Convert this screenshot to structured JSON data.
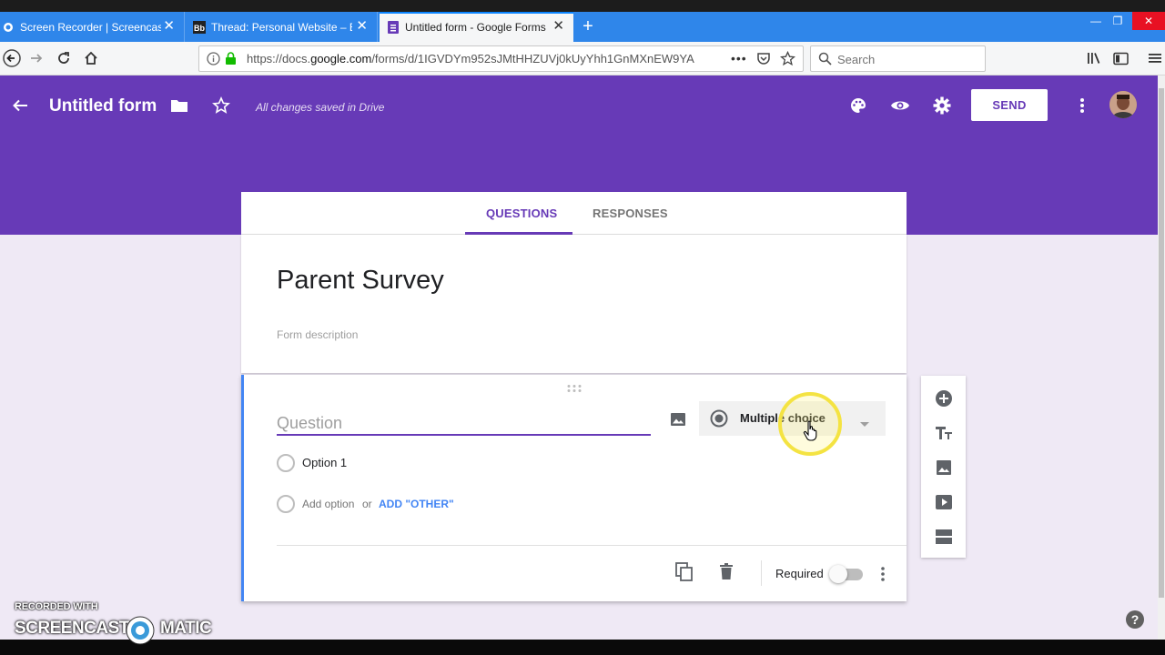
{
  "browser": {
    "tabs": [
      {
        "title": "Screen Recorder | Screencast-O"
      },
      {
        "title": "Thread: Personal Website – ED"
      },
      {
        "title": "Untitled form - Google Forms"
      }
    ],
    "url_prefix": "https://docs.",
    "url_host": "google.com",
    "url_rest": "/forms/d/1IGVDYm952sJMtHHZUVj0kUyYhh1GnMXnEW9YA",
    "search_placeholder": "Search"
  },
  "forms_header": {
    "title": "Untitled form",
    "save_status": "All changes saved in Drive",
    "send_label": "SEND"
  },
  "form_tabs": {
    "questions": "QUESTIONS",
    "responses": "RESPONSES",
    "active": "questions"
  },
  "form": {
    "title": "Parent Survey",
    "description_placeholder": "Form description"
  },
  "question": {
    "placeholder": "Question",
    "type": "Multiple choice",
    "options": [
      "Option 1"
    ],
    "add_option": "Add option",
    "or": "or",
    "add_other": "ADD \"OTHER\"",
    "required_label": "Required",
    "required": false
  },
  "side_toolbar": [
    "add-question-icon",
    "add-title-icon",
    "add-image-icon",
    "add-video-icon",
    "add-section-icon"
  ],
  "watermark": {
    "line1": "RECORDED WITH",
    "brand_left": "SCREENCAST",
    "brand_right": "MATIC"
  },
  "colors": {
    "theme": "#673ab7",
    "accent_blue": "#4285f4",
    "background": "#efe9f5"
  }
}
